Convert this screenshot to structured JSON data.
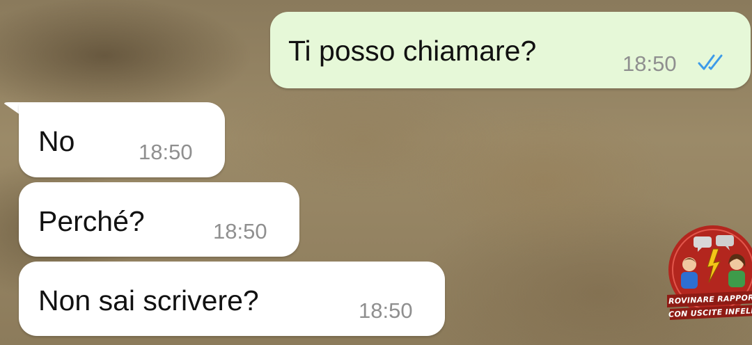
{
  "chat": {
    "messages": [
      {
        "direction": "outgoing",
        "text": "Ti posso chiamare?",
        "time": "18:50",
        "status_icon": "double-check-read-icon"
      },
      {
        "direction": "incoming",
        "text": "No",
        "time": "18:50"
      },
      {
        "direction": "incoming",
        "text": "Perché?",
        "time": "18:50"
      },
      {
        "direction": "incoming",
        "text": "Non sai scrivere?",
        "time": "18:50"
      }
    ]
  },
  "watermark": {
    "line1": "ROVINARE RAPPORTI",
    "line2": "CON USCITE INFELICI"
  },
  "colors": {
    "outgoing_bubble": "#e6f8d8",
    "incoming_bubble": "#ffffff",
    "read_ticks": "#3d9be9",
    "timestamp": "#8f8f8f",
    "logo_red": "#b3261e"
  }
}
